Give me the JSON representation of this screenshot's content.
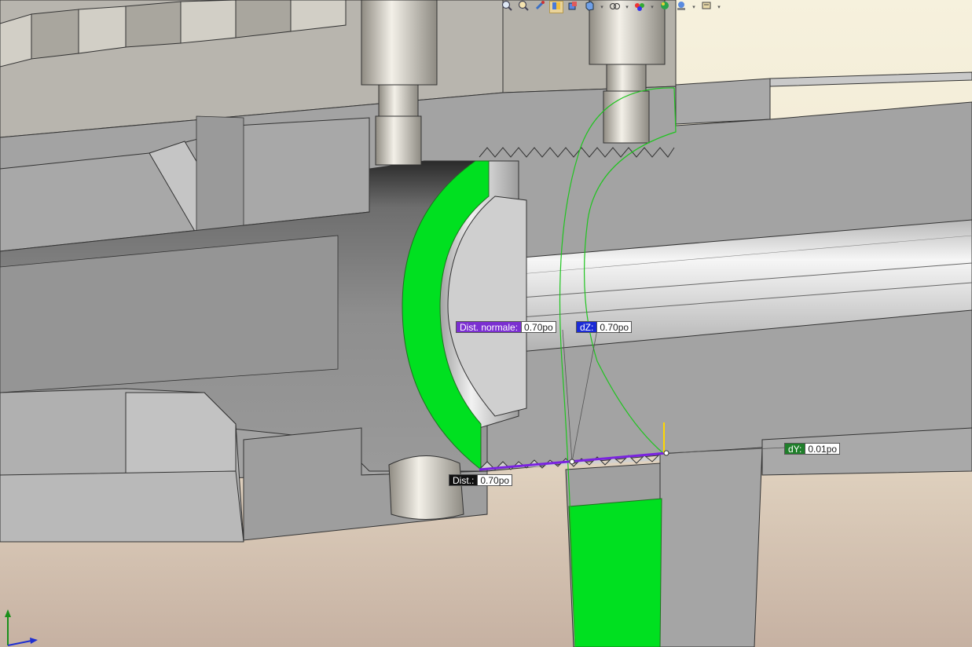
{
  "toolbar": {
    "buttons": [
      {
        "name": "zoom-to-fit-icon",
        "dropdown": false,
        "active": false
      },
      {
        "name": "zoom-area-icon",
        "dropdown": false,
        "active": false
      },
      {
        "name": "previous-view-icon",
        "dropdown": false,
        "active": false
      },
      {
        "name": "section-view-icon",
        "dropdown": false,
        "active": true
      },
      {
        "name": "dynamic-annotation-icon",
        "dropdown": false,
        "active": false
      },
      {
        "name": "view-orientation-icon",
        "dropdown": true,
        "active": false
      },
      {
        "name": "display-style-icon",
        "dropdown": true,
        "active": false
      },
      {
        "name": "hide-show-items-icon",
        "dropdown": true,
        "active": false
      },
      {
        "name": "edit-appearance-icon",
        "dropdown": false,
        "active": false
      },
      {
        "name": "apply-scene-icon",
        "dropdown": true,
        "active": false
      },
      {
        "name": "view-settings-icon",
        "dropdown": true,
        "active": false
      }
    ]
  },
  "measurements": {
    "normal_distance": {
      "key": "Dist. normale:",
      "value": "0.70po"
    },
    "dz": {
      "key": "dZ:",
      "value": "0.70po"
    },
    "dy": {
      "key": "dY:",
      "value": "0.01po"
    },
    "distance": {
      "key": "Dist.:",
      "value": "0.70po"
    }
  },
  "colors": {
    "selected_face": "#00e020",
    "measure_line": "#7a22e0",
    "dz_accent": "#1b2bd6",
    "dy_accent": "#1f7f2a",
    "model_gray": "#a3a3a3",
    "background_top": "#f5efd9",
    "background_bottom": "#c8b3a3"
  },
  "triad": {
    "axes": [
      "Y",
      "Z"
    ]
  }
}
